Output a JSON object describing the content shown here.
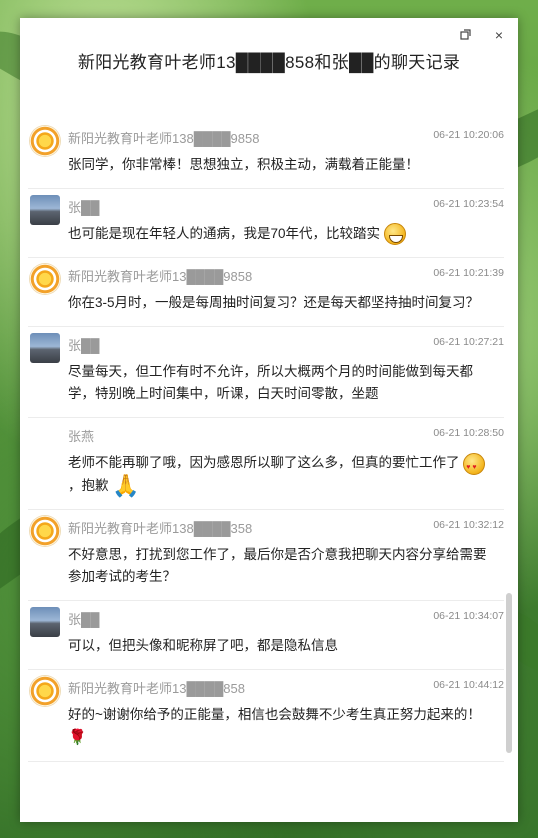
{
  "window": {
    "title": "新阳光教育叶老师13████858和张██的聊天记录",
    "restore_icon": "restore-icon",
    "close_icon": "close-icon",
    "close_glyph": "×"
  },
  "messages": [
    {
      "avatar": "sun-avatar",
      "sender": "新阳光教育叶老师138████9858",
      "time": "06-21 10:20:06",
      "text": "张同学，你非常棒！思想独立，积极主动，满载着正能量！",
      "emoji": ""
    },
    {
      "avatar": "photo-avatar",
      "sender": "张██",
      "time": "06-21 10:23:54",
      "text": "也可能是现在年轻人的通病，我是70年代，比较踏实",
      "emoji": "grin"
    },
    {
      "avatar": "sun-avatar",
      "sender": "新阳光教育叶老师13████9858",
      "time": "06-21 10:21:39",
      "text": "你在3-5月时，一般是每周抽时间复习？还是每天都坚持抽时间复习？",
      "emoji": ""
    },
    {
      "avatar": "photo-avatar",
      "sender": "张██",
      "time": "06-21 10:27:21",
      "text": "尽量每天，但工作有时不允许，所以大概两个月的时间能做到每天都学，特别晚上时间集中，听课，白天时间零散，坐题",
      "emoji": ""
    },
    {
      "avatar": "",
      "sender": "张燕",
      "time": "06-21 10:28:50",
      "text": "老师不能再聊了哦，因为感恩所以聊了这么多，但真的要忙工作了",
      "text_after": "，抱歉",
      "emoji": "love"
    },
    {
      "avatar": "sun-avatar",
      "sender": "新阳光教育叶老师138████358",
      "time": "06-21 10:32:12",
      "text": "不好意思，打扰到您工作了，最后你是否介意我把聊天内容分享给需要参加考试的考生？",
      "emoji": ""
    },
    {
      "avatar": "photo-avatar",
      "sender": "张██",
      "time": "06-21 10:34:07",
      "text": "可以，但把头像和昵称屏了吧，都是隐私信息",
      "emoji": ""
    },
    {
      "avatar": "sun-avatar",
      "sender": "新阳光教育叶老师13████858",
      "time": "06-21 10:44:12",
      "text": "好的~谢谢你给予的正能量，相信也会鼓舞不少考生真正努力起来的！",
      "emoji": "rose"
    }
  ]
}
